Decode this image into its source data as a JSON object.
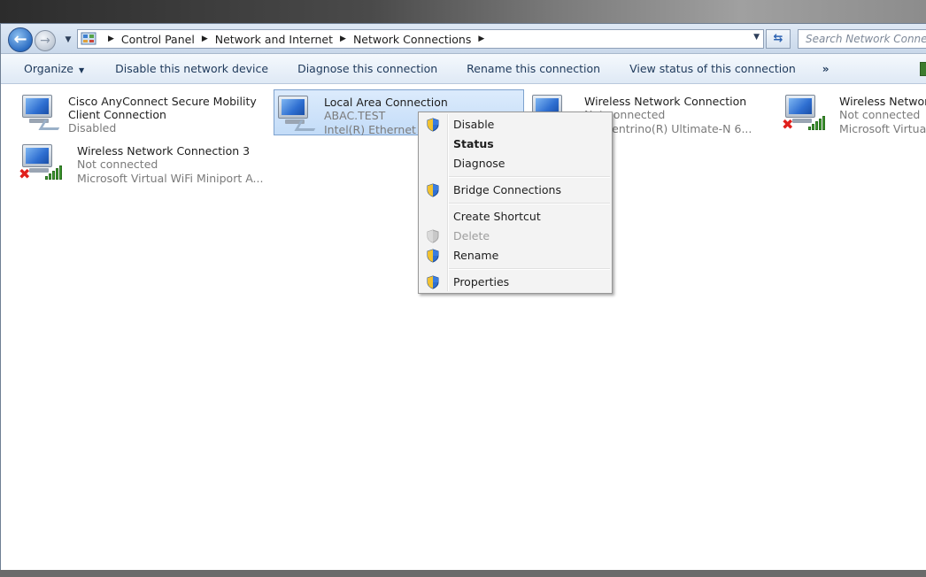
{
  "address_bar": {
    "breadcrumb": [
      "Control Panel",
      "Network and Internet",
      "Network Connections"
    ],
    "search_placeholder": "Search Network Conne"
  },
  "command_bar": {
    "organize": "Organize",
    "disable": "Disable this network device",
    "diagnose": "Diagnose this connection",
    "rename": "Rename this connection",
    "view_status": "View status of this connection",
    "more": "»"
  },
  "connections": [
    {
      "name_line1": "Cisco AnyConnect Secure Mobility",
      "name_line2": "Client Connection",
      "status": "Disabled",
      "type": "wired",
      "selected": false
    },
    {
      "name": "Local Area Connection",
      "status": "ABAC.TEST",
      "device": "Intel(R) Ethernet",
      "type": "wired",
      "selected": true
    },
    {
      "name": "Wireless Network Connection",
      "status": "Not connected",
      "device": "(R) Centrino(R) Ultimate-N 6...",
      "type": "wireless",
      "selected": false
    },
    {
      "name": "Wireless Networ",
      "status": "Not connected",
      "device": "Microsoft Virtua",
      "type": "wireless",
      "selected": false
    },
    {
      "name": "Wireless Network Connection 3",
      "status": "Not connected",
      "device": "Microsoft Virtual WiFi Miniport A...",
      "type": "wireless",
      "selected": false
    }
  ],
  "context_menu": {
    "items": [
      {
        "label": "Disable",
        "shield": true,
        "bold": false,
        "disabled": false
      },
      {
        "label": "Status",
        "shield": false,
        "bold": true,
        "disabled": false
      },
      {
        "label": "Diagnose",
        "shield": false,
        "bold": false,
        "disabled": false
      },
      {
        "label": "Bridge Connections",
        "shield": true,
        "bold": false,
        "disabled": false
      },
      {
        "label": "Create Shortcut",
        "shield": false,
        "bold": false,
        "disabled": false
      },
      {
        "label": "Delete",
        "shield": true,
        "bold": false,
        "disabled": true
      },
      {
        "label": "Rename",
        "shield": true,
        "bold": false,
        "disabled": false
      },
      {
        "label": "Properties",
        "shield": true,
        "bold": false,
        "disabled": false
      }
    ]
  },
  "colors": {
    "command_text": "#1e395b",
    "selection": "#c3dcf8",
    "status_grey": "#7a7a7a",
    "error_red": "#e0201c",
    "signal_green": "#3c9b2e"
  }
}
